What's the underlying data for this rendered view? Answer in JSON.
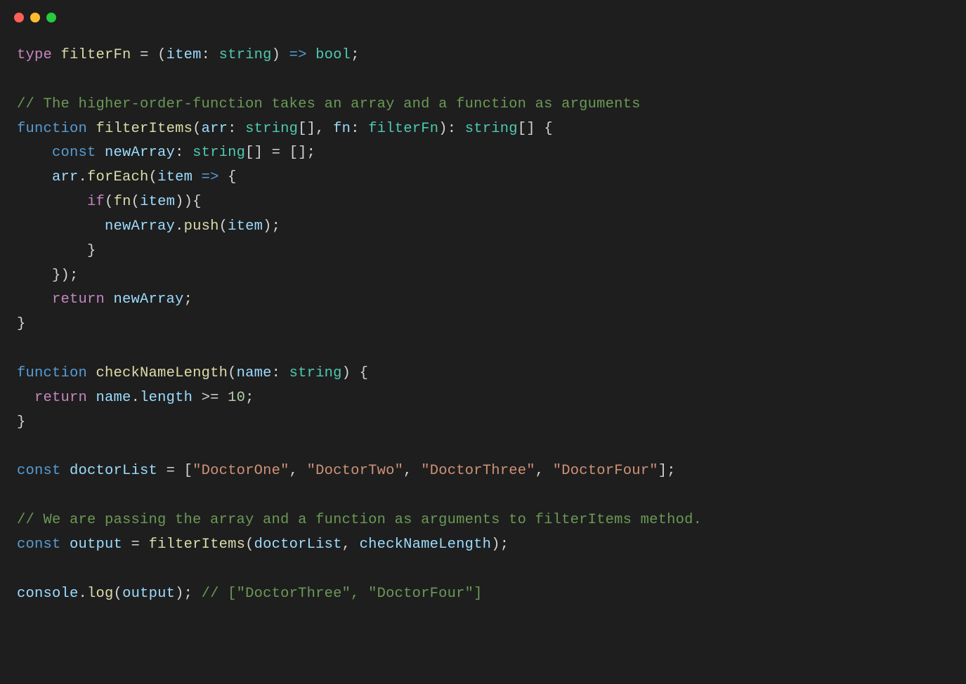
{
  "window": {
    "traffic_lights": [
      "red",
      "yellow",
      "green"
    ]
  },
  "code": {
    "l1": {
      "kw_type": "type",
      "id_filterFn": "filterFn",
      "eq": " = ",
      "lp": "(",
      "id_item": "item",
      "colon": ": ",
      "ty_string": "string",
      "rp": ")",
      "arrow": " => ",
      "ty_bool": "bool",
      "semi": ";"
    },
    "l2": "",
    "l3": {
      "comment": "// The higher-order-function takes an array and a function as arguments"
    },
    "l4": {
      "kw_function": "function",
      "sp": " ",
      "fn_filterItems": "filterItems",
      "lp": "(",
      "id_arr": "arr",
      "c1": ": ",
      "ty_string_arr": "string",
      "br1": "[]",
      "comma": ", ",
      "id_fn": "fn",
      "c2": ": ",
      "ty_filterFn": "filterFn",
      "rp": ")",
      "c3": ": ",
      "ty_ret": "string",
      "br2": "[]",
      "sp2": " ",
      "lb": "{"
    },
    "l5": {
      "indent": "    ",
      "kw_const": "const",
      "sp": " ",
      "id_newArray": "newArray",
      "c1": ": ",
      "ty_string": "string",
      "br": "[]",
      "eq": " = ",
      "empty": "[]",
      "semi": ";"
    },
    "l6": {
      "indent": "    ",
      "id_arr": "arr",
      "dot": ".",
      "fn_forEach": "forEach",
      "lp": "(",
      "id_item": "item",
      "arrow": " => ",
      "lb": "{"
    },
    "l7": {
      "indent": "        ",
      "kw_if": "if",
      "lp": "(",
      "fn_fn": "fn",
      "lp2": "(",
      "id_item": "item",
      "rp2": ")",
      "rp": ")",
      "lb": "{"
    },
    "l8": {
      "indent": "          ",
      "id_newArray": "newArray",
      "dot": ".",
      "fn_push": "push",
      "lp": "(",
      "id_item": "item",
      "rp": ")",
      "semi": ";"
    },
    "l9": {
      "indent": "        ",
      "rb": "}"
    },
    "l10": {
      "indent": "    ",
      "rb": "}",
      "rp": ")",
      "semi": ";"
    },
    "l11": {
      "indent": "    ",
      "kw_return": "return",
      "sp": " ",
      "id_newArray": "newArray",
      "semi": ";"
    },
    "l12": {
      "rb": "}"
    },
    "l13": "",
    "l14": {
      "kw_function": "function",
      "sp": " ",
      "fn_checkNameLength": "checkNameLength",
      "lp": "(",
      "id_name": "name",
      "c1": ": ",
      "ty_string": "string",
      "rp": ")",
      "sp2": " ",
      "lb": "{"
    },
    "l15": {
      "indent": "  ",
      "kw_return": "return",
      "sp": " ",
      "id_name": "name",
      "dot": ".",
      "id_length": "length",
      "op": " >= ",
      "num": "10",
      "semi": ";"
    },
    "l16": {
      "rb": "}"
    },
    "l17": "",
    "l18": {
      "kw_const": "const",
      "sp": " ",
      "id_doctorList": "doctorList",
      "eq": " = ",
      "lb": "[",
      "s1": "\"DoctorOne\"",
      "c1": ", ",
      "s2": "\"DoctorTwo\"",
      "c2": ", ",
      "s3": "\"DoctorThree\"",
      "c3": ", ",
      "s4": "\"DoctorFour\"",
      "rb": "]",
      "semi": ";"
    },
    "l19": "",
    "l20": {
      "comment": "// We are passing the array and a function as arguments to filterItems method."
    },
    "l21": {
      "kw_const": "const",
      "sp": " ",
      "id_output": "output",
      "eq": " = ",
      "fn_filterItems": "filterItems",
      "lp": "(",
      "id_doctorList": "doctorList",
      "comma": ", ",
      "id_checkNameLength": "checkNameLength",
      "rp": ")",
      "semi": ";"
    },
    "l22": "",
    "l23": {
      "id_console": "console",
      "dot": ".",
      "fn_log": "log",
      "lp": "(",
      "id_output": "output",
      "rp": ")",
      "semi": ";",
      "sp": " ",
      "comment": "// [\"DoctorThree\", \"DoctorFour\"]"
    }
  }
}
